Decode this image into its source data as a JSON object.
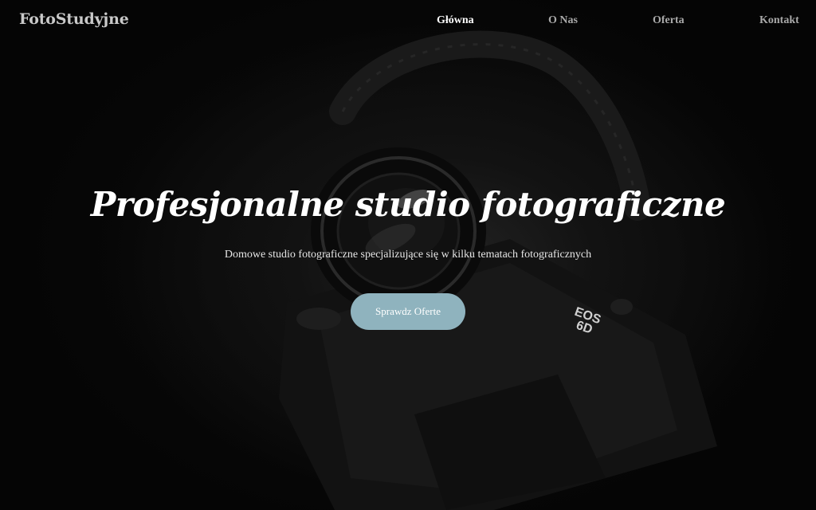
{
  "brand": {
    "name": "FotoStudyjne"
  },
  "nav": {
    "items": [
      {
        "label": "Główna",
        "active": true
      },
      {
        "label": "O Nas",
        "active": false
      },
      {
        "label": "Oferta",
        "active": false
      },
      {
        "label": "Kontakt",
        "active": false
      }
    ]
  },
  "hero": {
    "title": "Profesjonalne studio fotograficzne",
    "subtitle": "Domowe studio fotograficzne specjalizujące się w kilku tematach fotograficznych",
    "cta_label": "Sprawdz Oferte",
    "background_image": "dark-camera-photo",
    "camera_markings": [
      "EOS",
      "6D"
    ]
  },
  "colors": {
    "background": "#050505",
    "cta": "#8fb3be",
    "nav_active": "#ffffff",
    "nav_inactive": "#a9a9a9",
    "brand": "#c9c9c9"
  }
}
